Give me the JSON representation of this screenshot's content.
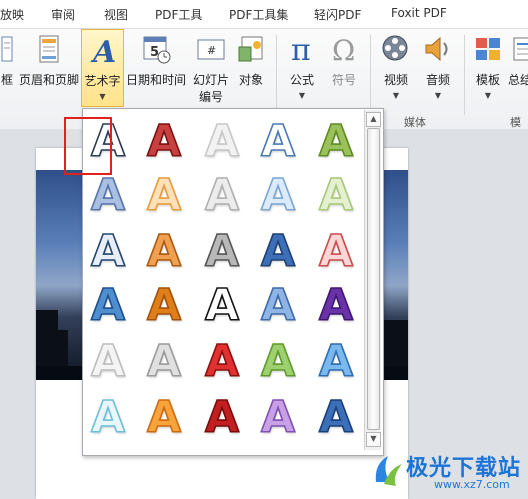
{
  "menu_tabs": [
    "放映",
    "审阅",
    "视图",
    "PDF工具",
    "PDF工具集",
    "轻闪PDF",
    "Foxit PDF"
  ],
  "ribbon": {
    "textbox_partial": "框",
    "header_footer": "页眉和页脚",
    "wordart": "艺术字",
    "datetime": "日期和时间",
    "slide_number_1": "幻灯片",
    "slide_number_2": "编号",
    "object": "对象",
    "formula": "公式",
    "symbol": "符号",
    "video": "视频",
    "audio": "音频",
    "media_group": "媒体",
    "template": "模板",
    "summary_partial": "总结",
    "template_group_partial": "模板"
  },
  "gallery": {
    "rows": [
      [
        {
          "fill": "#ffffff",
          "stroke": "#2b3a55"
        },
        {
          "fill": "#c94040",
          "stroke": "#7a1212"
        },
        {
          "fill": "#f2f2f2",
          "stroke": "#c8c8c8"
        },
        {
          "fill": "#ffffff",
          "stroke": "#4a79b8"
        },
        {
          "fill": "#9bc25a",
          "stroke": "#5e8a24"
        }
      ],
      [
        {
          "fill": "#a9c0e2",
          "stroke": "#5574a8"
        },
        {
          "fill": "#ffe0b8",
          "stroke": "#e69a3c"
        },
        {
          "fill": "#ececec",
          "stroke": "#b0b0b0"
        },
        {
          "fill": "#dcebfb",
          "stroke": "#7aa6d6"
        },
        {
          "fill": "#e4f0cf",
          "stroke": "#a7c878"
        }
      ],
      [
        {
          "fill": "#e8eef8",
          "stroke": "#23456e"
        },
        {
          "fill": "#f0a050",
          "stroke": "#a85a10"
        },
        {
          "fill": "#b8b8b8",
          "stroke": "#555555"
        },
        {
          "fill": "#3d6fb8",
          "stroke": "#20406f"
        },
        {
          "fill": "#ffd6d6",
          "stroke": "#c84a4a"
        }
      ],
      [
        {
          "fill": "#4f8fd0",
          "stroke": "#1d4f8a"
        },
        {
          "fill": "#e07e1a",
          "stroke": "#a0520a"
        },
        {
          "fill": "#ffffff",
          "stroke": "#111111"
        },
        {
          "fill": "#8fb4e6",
          "stroke": "#3d6aa8"
        },
        {
          "fill": "#6a32a8",
          "stroke": "#3e1770"
        }
      ],
      [
        {
          "fill": "#f4f4f4",
          "stroke": "#bdbdbd"
        },
        {
          "fill": "#e0e0e0",
          "stroke": "#9a9a9a"
        },
        {
          "fill": "#e03030",
          "stroke": "#8a1010"
        },
        {
          "fill": "#9fd070",
          "stroke": "#5e9a2a"
        },
        {
          "fill": "#7ab8ee",
          "stroke": "#2e6db0"
        }
      ],
      [
        {
          "fill": "#e9f6fb",
          "stroke": "#6bbfd8"
        },
        {
          "fill": "#f7a43a",
          "stroke": "#cc6a10"
        },
        {
          "fill": "#c22020",
          "stroke": "#7a0a0a"
        },
        {
          "fill": "#c8a0e8",
          "stroke": "#8050b0"
        },
        {
          "fill": "#3b6fb8",
          "stroke": "#1a3f78"
        }
      ]
    ]
  },
  "logo": {
    "title": "极光下载站",
    "url": "www.xz7.com"
  }
}
